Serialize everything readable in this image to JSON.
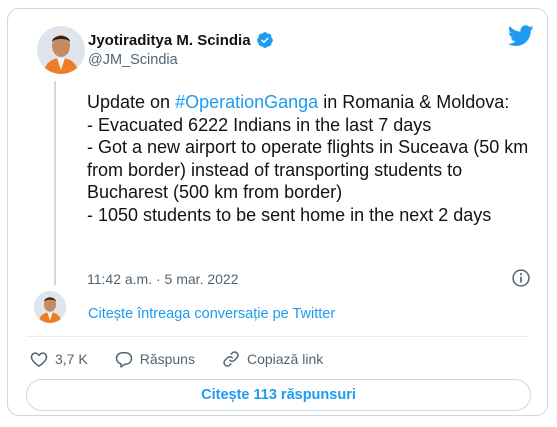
{
  "author": {
    "display_name": "Jyotiraditya M. Scindia",
    "handle": "@JM_Scindia",
    "verified_icon": "verified-badge-icon"
  },
  "brand": {
    "logo_icon": "twitter-bird-icon",
    "accent": "#1d9bf0"
  },
  "tweet": {
    "text_before": "Update on ",
    "hashtag": "#OperationGanga",
    "text_after": " in Romania & Moldova:\n- Evacuated 6222 Indians in the last 7 days\n- Got a new airport to operate flights in Suceava (50 km from border) instead of transporting students to Bucharest (500 km from border)\n- 1050 students to be sent home in the next 2 days",
    "timestamp": "11:42 a.m. · 5 mar. 2022"
  },
  "conversation_link": "Citește întreaga conversație pe Twitter",
  "actions": {
    "like_count": "3,7 K",
    "reply_label": "Răspuns",
    "copy_label": "Copiază link"
  },
  "read_replies_label": "Citește 113 răspunsuri"
}
